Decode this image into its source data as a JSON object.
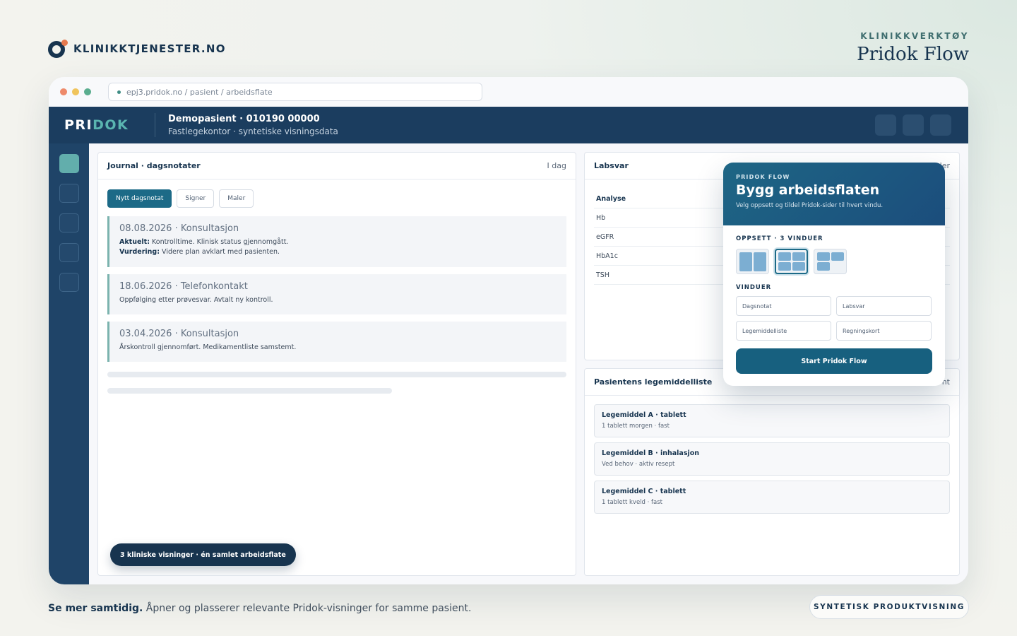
{
  "brand": {
    "name": "KLINIKKTJENESTER.NO"
  },
  "header": {
    "kicker": "KLINIKKVERKTØY",
    "title": "Pridok Flow"
  },
  "browser": {
    "url": "epj3.pridok.no / pasient / arbeidsflate",
    "traffic_colors": [
      "#ee8a6a",
      "#f0c45c",
      "#5aad8e"
    ]
  },
  "app": {
    "logo_a": "PRI",
    "logo_b": "DOK",
    "patient_name": "Demopasient · 010190 00000",
    "patient_sub": "Fastlegekontor · syntetiske visningsdata"
  },
  "journal": {
    "title": "Journal · dagsnotater",
    "meta": "I dag",
    "buttons": {
      "new": "Nytt dagsnotat",
      "sign": "Signer",
      "templates": "Maler"
    },
    "notes": [
      {
        "title": "08.08.2026 · Konsultasjon",
        "l1_label": "Aktuelt:",
        "l1_text": " Kontrolltime. Klinisk status gjennomgått.",
        "l2_label": "Vurdering:",
        "l2_text": " Videre plan avklart med pasienten."
      },
      {
        "title": "18.06.2026 · Telefonkontakt",
        "text": "Oppfølging etter prøvesvar. Avtalt ny kontroll."
      },
      {
        "title": "03.04.2026 · Konsultasjon",
        "text": "Årskontroll gjennomført. Medikamentliste samstemt."
      }
    ],
    "pill": "3 kliniske visninger · én samlet arbeidsflate"
  },
  "lab": {
    "title": "Labsvar",
    "meta": "ler",
    "header": "Analyse",
    "rows": [
      "Hb",
      "eGFR",
      "HbA1c",
      "TSH"
    ]
  },
  "meds": {
    "title": "Pasientens legemiddelliste",
    "meta": "nt",
    "items": [
      {
        "name": "Legemiddel A · tablett",
        "sub": "1 tablett morgen · fast"
      },
      {
        "name": "Legemiddel B · inhalasjon",
        "sub": "Ved behov · aktiv resept"
      },
      {
        "name": "Legemiddel C · tablett",
        "sub": "1 tablett kveld · fast"
      }
    ]
  },
  "flow": {
    "kicker": "PRIDOK FLOW",
    "title": "Bygg arbeidsflaten",
    "subtitle": "Velg oppsett og tildel Pridok-sider til hvert vindu.",
    "layout_label": "OPPSETT · 3 VINDUER",
    "windows_label": "VINDUER",
    "windows": [
      "Dagsnotat",
      "Labsvar",
      "Legemiddelliste",
      "Regningskort"
    ],
    "start": "Start Pridok Flow"
  },
  "footer": {
    "bold": "Se mer samtidig.",
    "text": " Åpner og plasserer relevante Pridok-visninger for samme pasient.",
    "badge": "SYNTETISK PRODUKTVISNING"
  }
}
